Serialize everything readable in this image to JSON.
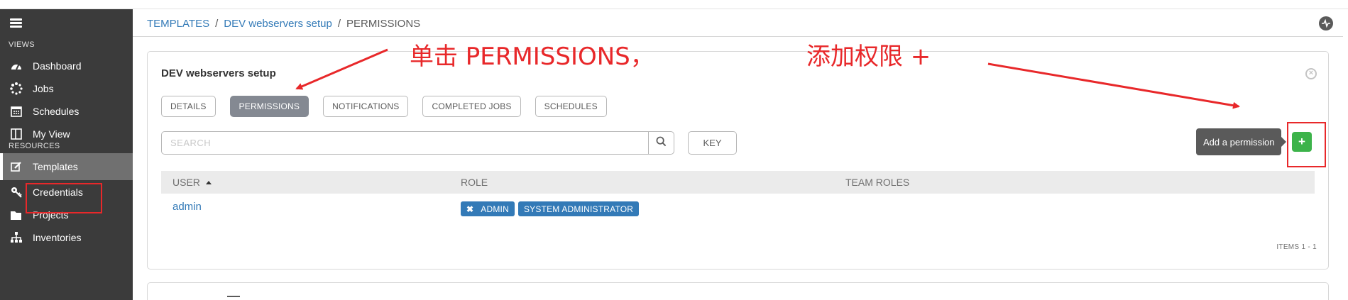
{
  "sidebar": {
    "views_label": "VIEWS",
    "resources_label": "RESOURCES",
    "items": [
      {
        "label": "Dashboard",
        "icon": "dashboard-icon"
      },
      {
        "label": "Jobs",
        "icon": "spinner-icon"
      },
      {
        "label": "Schedules",
        "icon": "calendar-icon"
      },
      {
        "label": "My View",
        "icon": "columns-icon"
      },
      {
        "label": "Templates",
        "icon": "edit-icon"
      },
      {
        "label": "Credentials",
        "icon": "key-icon"
      },
      {
        "label": "Projects",
        "icon": "folder-icon"
      },
      {
        "label": "Inventories",
        "icon": "sitemap-icon"
      }
    ]
  },
  "breadcrumb": {
    "item1": "TEMPLATES",
    "item2": "DEV webservers setup",
    "current": "PERMISSIONS",
    "sep": "/"
  },
  "panel": {
    "title": "DEV webservers setup",
    "tabs": [
      "DETAILS",
      "PERMISSIONS",
      "NOTIFICATIONS",
      "COMPLETED JOBS",
      "SCHEDULES"
    ],
    "active_tab": "PERMISSIONS",
    "search_placeholder": "SEARCH",
    "key_label": "KEY",
    "tooltip": "Add a permission",
    "add_label": "+",
    "columns": [
      "USER",
      "ROLE",
      "TEAM ROLES"
    ],
    "rows": [
      {
        "user": "admin",
        "roles": [
          "ADMIN",
          "SYSTEM ADMINISTRATOR"
        ]
      }
    ],
    "remove_mark": "✖",
    "items_count": "ITEMS  1 - 1"
  },
  "annotations": {
    "text1": "单击 PERMISSIONS，",
    "text2": "添加权限 +"
  },
  "colors": {
    "sidebar_bg": "#3b3b3b",
    "link": "#337ab7",
    "add_button": "#3cb34a",
    "annotation": "#e8282a"
  }
}
